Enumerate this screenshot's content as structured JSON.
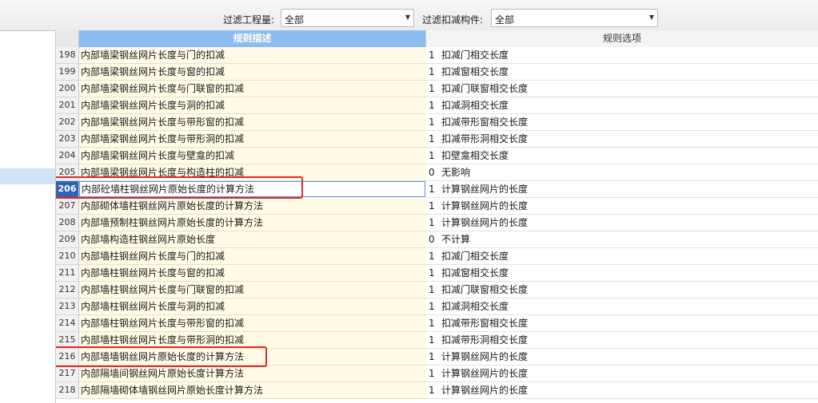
{
  "filters": {
    "engineering_label": "过滤工程量:",
    "engineering_value": "全部",
    "component_label": "过滤扣减构件:",
    "component_value": "全部"
  },
  "columns": {
    "description": "规则描述",
    "options": "规则选项"
  },
  "rows": [
    {
      "no": "198",
      "desc": "内部墙梁钢丝网片长度与门的扣减",
      "val": "1",
      "opt": "扣减门相交长度"
    },
    {
      "no": "199",
      "desc": "内部墙梁钢丝网片长度与窗的扣减",
      "val": "1",
      "opt": "扣减窗相交长度"
    },
    {
      "no": "200",
      "desc": "内部墙梁钢丝网片长度与门联窗的扣减",
      "val": "1",
      "opt": "扣减门联窗相交长度"
    },
    {
      "no": "201",
      "desc": "内部墙梁钢丝网片长度与洞的扣减",
      "val": "1",
      "opt": "扣减洞相交长度"
    },
    {
      "no": "202",
      "desc": "内部墙梁钢丝网片长度与带形窗的扣减",
      "val": "1",
      "opt": "扣减带形窗相交长度"
    },
    {
      "no": "203",
      "desc": "内部墙梁钢丝网片长度与带形洞的扣减",
      "val": "1",
      "opt": "扣减带形洞相交长度"
    },
    {
      "no": "204",
      "desc": "内部墙梁钢丝网片长度与壁龛的扣减",
      "val": "1",
      "opt": "扣壁龛相交长度"
    },
    {
      "no": "205",
      "desc": "内部墙梁钢丝网片长度与构造柱的扣减",
      "val": "0",
      "opt": "无影响"
    },
    {
      "no": "206",
      "desc": "内部砼墙柱钢丝网片原始长度的计算方法",
      "val": "1",
      "opt": "计算钢丝网片的长度",
      "selected": true
    },
    {
      "no": "207",
      "desc": "内部砌体墙柱钢丝网片原始长度的计算方法",
      "val": "1",
      "opt": "计算钢丝网片的长度"
    },
    {
      "no": "208",
      "desc": "内部墙预制柱钢丝网片原始长度的计算方法",
      "val": "1",
      "opt": "计算钢丝网片的长度"
    },
    {
      "no": "209",
      "desc": "内部墙构造柱钢丝网片原始长度",
      "val": "0",
      "opt": "不计算"
    },
    {
      "no": "210",
      "desc": "内部墙柱钢丝网片长度与门的扣减",
      "val": "1",
      "opt": "扣减门相交长度"
    },
    {
      "no": "211",
      "desc": "内部墙柱钢丝网片长度与窗的扣减",
      "val": "1",
      "opt": "扣减窗相交长度"
    },
    {
      "no": "212",
      "desc": "内部墙柱钢丝网片长度与门联窗的扣减",
      "val": "1",
      "opt": "扣减门联窗相交长度"
    },
    {
      "no": "213",
      "desc": "内部墙柱钢丝网片长度与洞的扣减",
      "val": "1",
      "opt": "扣减洞相交长度"
    },
    {
      "no": "214",
      "desc": "内部墙柱钢丝网片长度与带形窗的扣减",
      "val": "1",
      "opt": "扣减带形窗相交长度"
    },
    {
      "no": "215",
      "desc": "内部墙柱钢丝网片长度与带形洞的扣减",
      "val": "1",
      "opt": "扣减带形洞相交长度"
    },
    {
      "no": "216",
      "desc": "内部墙墙钢丝网片原始长度的计算方法",
      "val": "1",
      "opt": "计算钢丝网片的长度"
    },
    {
      "no": "217",
      "desc": "内部隔墙间钢丝网片原始长度计算方法",
      "val": "1",
      "opt": "计算钢丝网片的长度"
    },
    {
      "no": "218",
      "desc": "内部隔墙砌体墙钢丝网片原始长度计算方法",
      "val": "1",
      "opt": "计算钢丝网片的长度"
    }
  ],
  "colors": {
    "header_accent": "#8dbdf0",
    "selected_row": "#2f64b5",
    "highlight_box": "#e5262a"
  }
}
